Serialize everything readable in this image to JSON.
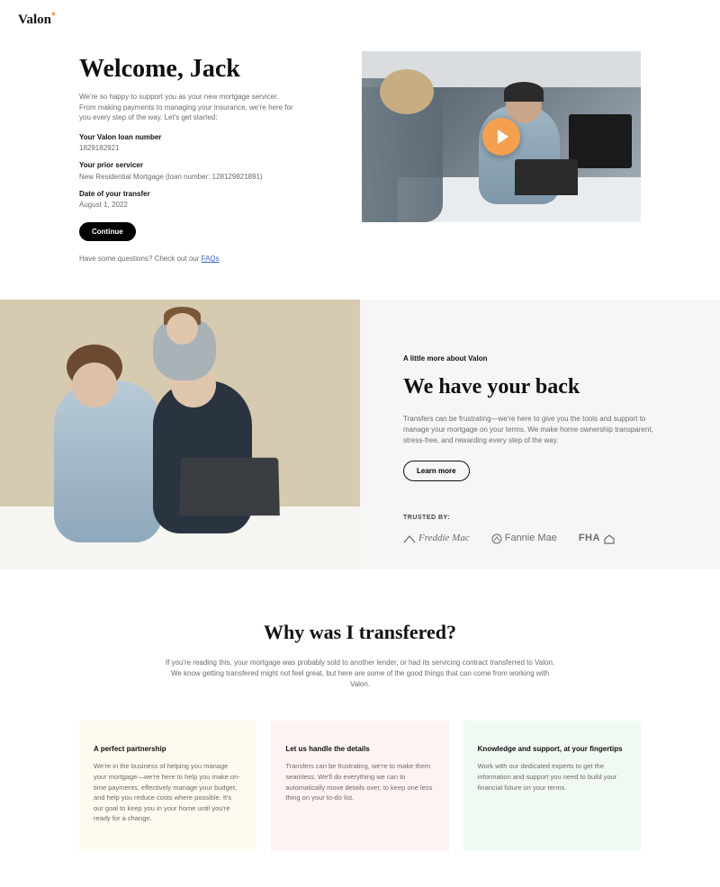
{
  "header": {
    "logo": "Valon"
  },
  "hero": {
    "title": "Welcome, Jack",
    "subtitle": "We're so happy to support you as your new mortgage servicer. From making payments to managing your insurance, we're here for you every step of the way. Let's get started:",
    "loan_label": "Your Valon loan number",
    "loan_value": "1829182921",
    "prior_label": "Your prior servicer",
    "prior_value": "New Residential Mortgage (loan number: 128129821891)",
    "transfer_label": "Date of your transfer",
    "transfer_value": "August 1, 2022",
    "continue": "Continue",
    "faq_prefix": "Have some questions? Check out our ",
    "faq_link": "FAQs"
  },
  "about": {
    "eyebrow": "A little more about Valon",
    "title": "We have your back",
    "body": "Transfers can be frustrating—we're here to give you the tools and support to manage your mortgage on your terms. We make home ownership transparent, stress-free, and rewarding every step of the way.",
    "learn": "Learn more",
    "trusted_label": "TRUSTED BY:",
    "trust1": "Freddie Mac",
    "trust2": "Fannie Mae",
    "trust3": "FHA"
  },
  "transfer": {
    "title": "Why was I transfered?",
    "body": "If you're reading this, your mortgage was probably sold to another lender, or had its servicing contract transferred to Valon. We know getting transfered might not feel great, but here are some of the good things that can come from working with Valon.",
    "cards": [
      {
        "title": "A perfect partnership",
        "body": "We're in the business of helping you manage your mortgage—we're here to help you make on-time payments, effectively manage your budget, and help you reduce costs where possible. It's our goal to keep you in your home until you're ready for a change."
      },
      {
        "title": "Let us handle the details",
        "body": "Transfers can be frustrating, we're to make them seamless. We'll do everything we can to automatically move details over, to keep one less thing on your to-do list."
      },
      {
        "title": "Knowledge and support, at your fingertips",
        "body": "Work with our dedicated experts to get the information and support you need to build your financial future on your terms."
      }
    ]
  }
}
